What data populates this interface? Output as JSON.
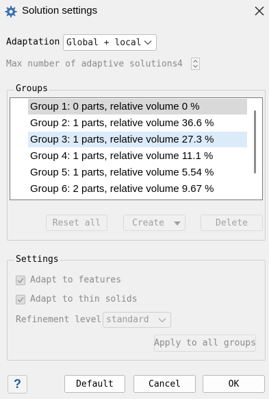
{
  "window": {
    "title": "Solution settings",
    "app_icon": "gear-icon",
    "close_icon": "close-icon"
  },
  "adaptation": {
    "label": "Adaptation",
    "value": "Global + local"
  },
  "max_solutions": {
    "label": "Max number of adaptive solutions",
    "value": "4"
  },
  "groups": {
    "title": "Groups",
    "items": [
      {
        "label": "Group 1:  0 parts, relative volume 0 %",
        "state": "selected-inactive"
      },
      {
        "label": "Group 2:  1 parts, relative volume 36.6 %",
        "state": "normal"
      },
      {
        "label": "Group 3:  1 parts, relative volume 27.3 %",
        "state": "hover"
      },
      {
        "label": "Group 4:  1 parts, relative volume 11.1 %",
        "state": "normal"
      },
      {
        "label": "Group 5:  1 parts, relative volume 5.54 %",
        "state": "normal"
      },
      {
        "label": "Group 6:  2 parts, relative volume 9.67 %",
        "state": "normal"
      }
    ],
    "reset_label": "Reset all",
    "create_label": "Create",
    "delete_label": "Delete"
  },
  "settings": {
    "title": "Settings",
    "adapt_features_label": "Adapt to features",
    "adapt_thin_label": "Adapt to thin solids",
    "refinement_label": "Refinement level",
    "refinement_value": "standard",
    "apply_label": "Apply to all groups"
  },
  "footer": {
    "help_label": "?",
    "default_label": "Default",
    "cancel_label": "Cancel",
    "ok_label": "OK"
  },
  "colors": {
    "background": "#f0f0f0",
    "selected_row": "#d9d9d9",
    "hover_row": "#dcebfa",
    "help_icon": "#1e5a99"
  }
}
